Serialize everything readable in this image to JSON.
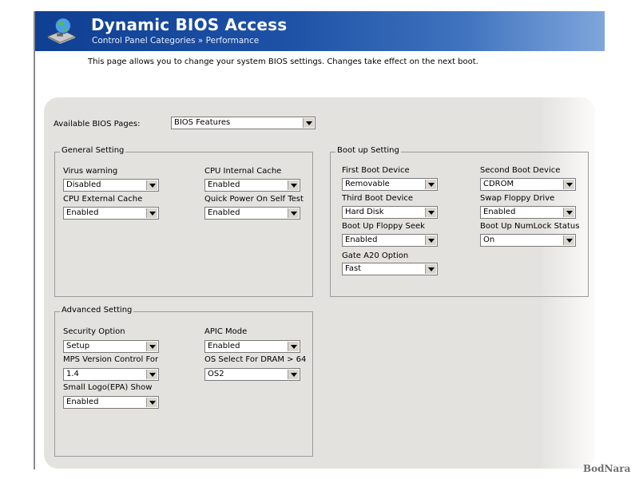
{
  "header": {
    "title": "Dynamic BIOS Access",
    "breadcrumb": "Control Panel Categories  »  Performance"
  },
  "intro": "This page allows you to change your system BIOS settings.  Changes take effect on the next boot.",
  "bios_pages": {
    "label": "Available BIOS Pages:",
    "value": "BIOS Features"
  },
  "general": {
    "legend": "General Setting",
    "fields": [
      {
        "label": "Virus warning",
        "value": "Disabled"
      },
      {
        "label": "CPU Internal Cache",
        "value": "Enabled"
      },
      {
        "label": "CPU External Cache",
        "value": "Enabled"
      },
      {
        "label": "Quick Power On Self Test",
        "value": "Enabled"
      }
    ]
  },
  "boot": {
    "legend": "Boot up Setting",
    "fields": [
      {
        "label": "First Boot Device",
        "value": "Removable"
      },
      {
        "label": "Second Boot Device",
        "value": "CDROM"
      },
      {
        "label": "Third Boot Device",
        "value": "Hard Disk"
      },
      {
        "label": "Swap Floppy Drive",
        "value": "Enabled"
      },
      {
        "label": "Boot Up Floppy Seek",
        "value": "Enabled"
      },
      {
        "label": "Boot Up NumLock Status",
        "value": "On"
      },
      {
        "label": "Gate A20 Option",
        "value": "Fast"
      }
    ]
  },
  "advanced": {
    "legend": "Advanced Setting",
    "fields": [
      {
        "label": "Security Option",
        "value": "Setup"
      },
      {
        "label": "APIC Mode",
        "value": "Enabled"
      },
      {
        "label": "MPS Version Control For",
        "value": "1.4"
      },
      {
        "label": "OS Select For DRAM > 64",
        "value": "OS2"
      },
      {
        "label": "Small Logo(EPA) Show",
        "value": "Enabled"
      }
    ]
  },
  "watermark": "BodNara",
  "icons": {
    "logo": "motherboard-globe-icon",
    "dropdown": "chevron-down-icon"
  }
}
